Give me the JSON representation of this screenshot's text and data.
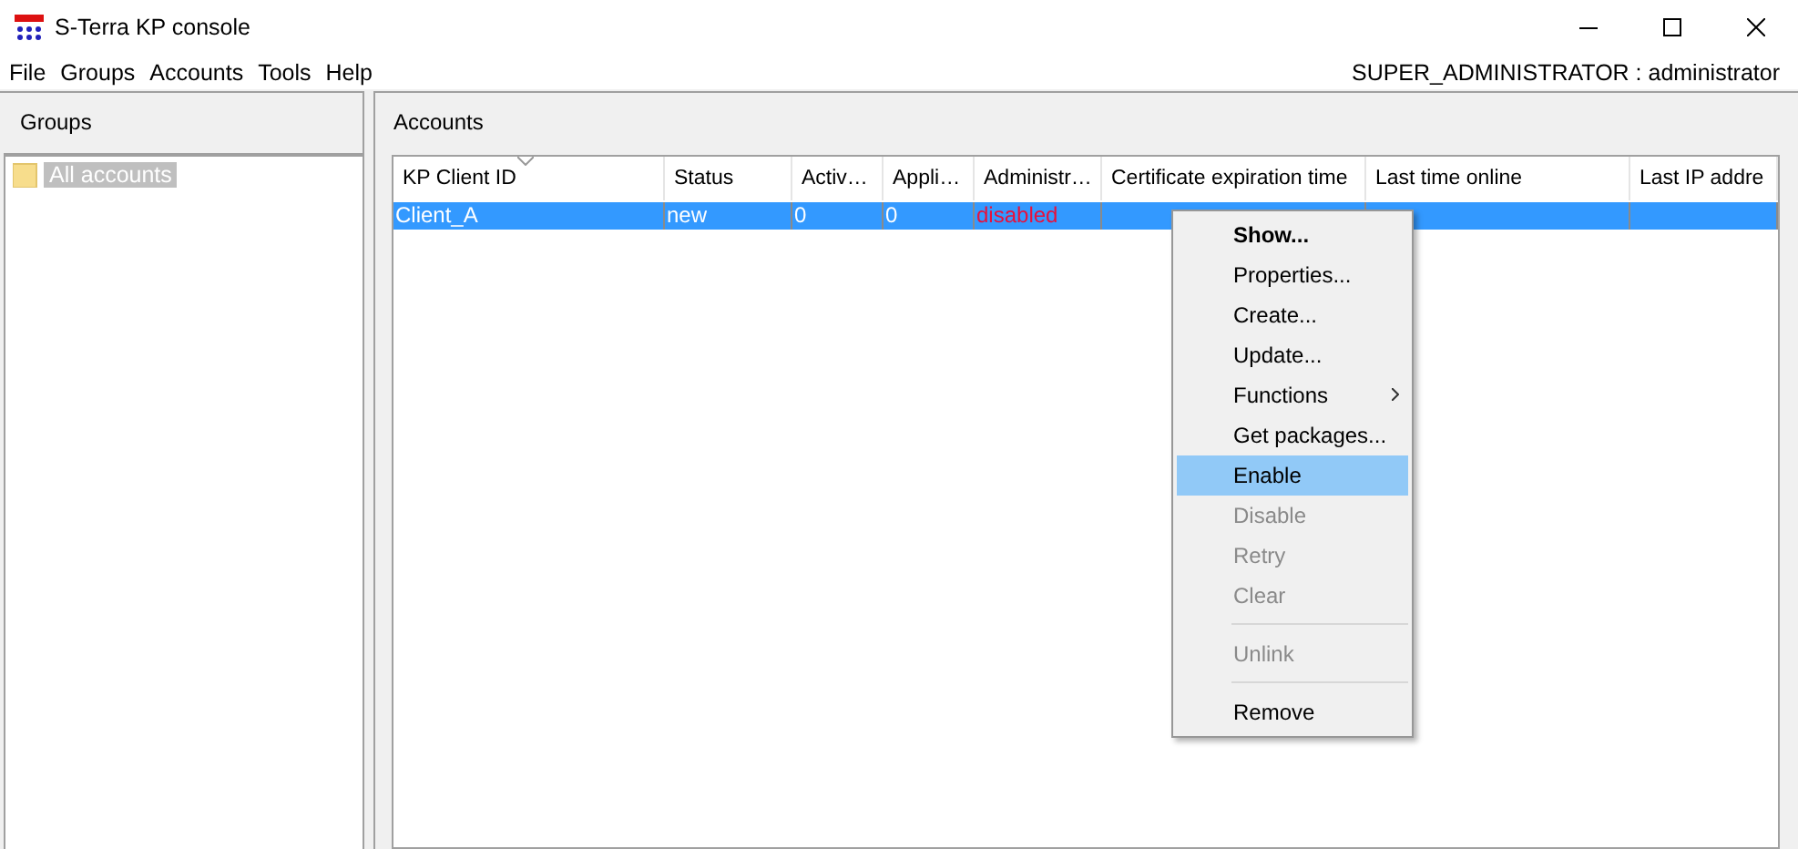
{
  "window": {
    "title": "S-Terra KP console"
  },
  "menu_bar": {
    "items": [
      "File",
      "Groups",
      "Accounts",
      "Tools",
      "Help"
    ],
    "user": "SUPER_ADMINISTRATOR : administrator"
  },
  "groups_panel": {
    "title": "Groups",
    "tree": [
      {
        "label": "All accounts",
        "selected": true
      }
    ]
  },
  "accounts_panel": {
    "title": "Accounts",
    "table": {
      "columns": [
        {
          "label": "KP Client ID",
          "sorted": true
        },
        {
          "label": "Status",
          "sorted": false
        },
        {
          "label": "Activ…",
          "sorted": false
        },
        {
          "label": "Appli…",
          "sorted": false
        },
        {
          "label": "Administr…",
          "sorted": false
        },
        {
          "label": "Certificate expiration time",
          "sorted": false
        },
        {
          "label": "Last time online",
          "sorted": false
        },
        {
          "label": "Last IP addre",
          "sorted": false
        }
      ],
      "rows": [
        {
          "selected": true,
          "cells": [
            {
              "text": "Client_A"
            },
            {
              "text": "new"
            },
            {
              "text": "0"
            },
            {
              "text": "0"
            },
            {
              "text": "disabled",
              "color": "#e8103c"
            }
          ]
        }
      ]
    }
  },
  "context_menu": {
    "items": [
      {
        "kind": "default",
        "label": "Show...",
        "disabled": false,
        "selected": false
      },
      {
        "kind": "item",
        "label": "Properties...",
        "disabled": false,
        "selected": false
      },
      {
        "kind": "item",
        "label": "Create...",
        "disabled": false,
        "selected": false
      },
      {
        "kind": "item",
        "label": "Update...",
        "disabled": false,
        "selected": false
      },
      {
        "kind": "submenu",
        "label": "Functions",
        "disabled": false,
        "selected": false
      },
      {
        "kind": "item",
        "label": "Get packages...",
        "disabled": false,
        "selected": false
      },
      {
        "kind": "item",
        "label": "Enable",
        "disabled": false,
        "selected": true
      },
      {
        "kind": "item",
        "label": "Disable",
        "disabled": true,
        "selected": false
      },
      {
        "kind": "item",
        "label": "Retry",
        "disabled": true,
        "selected": false
      },
      {
        "kind": "item",
        "label": "Clear",
        "disabled": true,
        "selected": false
      },
      {
        "kind": "separator"
      },
      {
        "kind": "item",
        "label": "Unlink",
        "disabled": true,
        "selected": false
      },
      {
        "kind": "separator"
      },
      {
        "kind": "item",
        "label": "Remove",
        "disabled": false,
        "selected": false
      }
    ]
  }
}
